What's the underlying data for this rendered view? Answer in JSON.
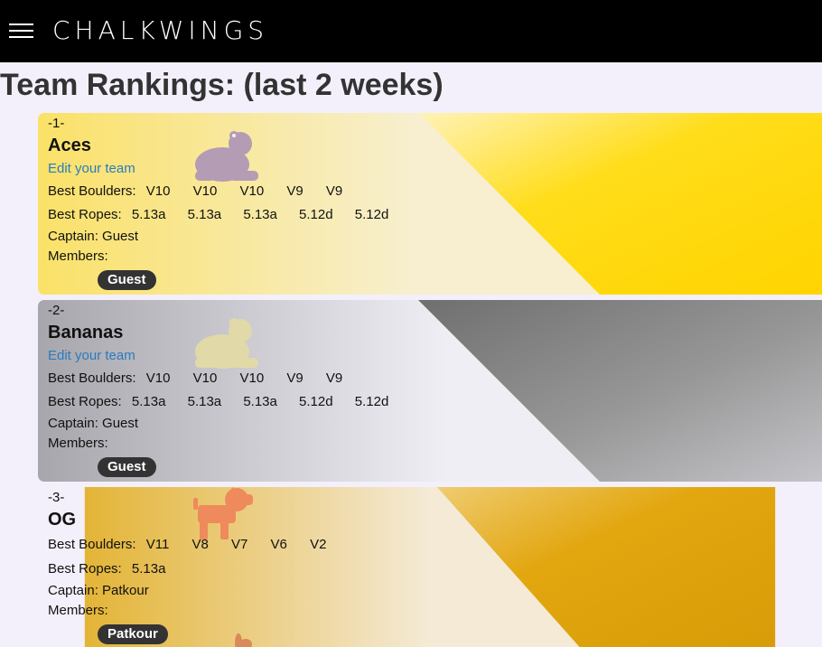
{
  "header": {
    "brand": "CHALKWINGS",
    "menu_icon": "hamburger-menu-icon"
  },
  "page_title": "Team Rankings: (last 2 weeks)",
  "teams": [
    {
      "rank": "-1-",
      "name": "Aces",
      "edit_label": "Edit your team",
      "boulders_label": "Best Boulders:",
      "boulders": [
        "V10",
        "V10",
        "V10",
        "V9",
        "V9"
      ],
      "ropes_label": "Best Ropes:",
      "ropes": [
        "5.13a",
        "5.13a",
        "5.13a",
        "5.12d",
        "5.12d"
      ],
      "captain": "Captain: Guest",
      "members_label": "Members:",
      "members": [
        "Guest"
      ],
      "icon": "frog-icon",
      "icon_color": "#b49cb4",
      "theme_colors": [
        "#fbe47a",
        "#ffd800"
      ]
    },
    {
      "rank": "-2-",
      "name": "Bananas",
      "edit_label": "Edit your team",
      "boulders_label": "Best Boulders:",
      "boulders": [
        "V10",
        "V10",
        "V10",
        "V9",
        "V9"
      ],
      "ropes_label": "Best Ropes:",
      "ropes": [
        "5.13a",
        "5.13a",
        "5.13a",
        "5.12d",
        "5.12d"
      ],
      "captain": "Captain: Guest",
      "members_label": "Members:",
      "members": [
        "Guest"
      ],
      "icon": "frog-icon",
      "icon_color": "#e2d9a8",
      "theme_colors": [
        "#a9a8ae",
        "#707070"
      ]
    },
    {
      "rank": "-3-",
      "name": "OG",
      "boulders_label": "Best Boulders:",
      "boulders": [
        "V11",
        "V8",
        "V7",
        "V6",
        "V2"
      ],
      "ropes_label": "Best Ropes:",
      "ropes": [
        "5.13a"
      ],
      "captain": "Captain: Patkour",
      "members_label": "Members:",
      "members": [
        "Patkour"
      ],
      "icon": "dog-icon",
      "icon_color": "#ef8a5c",
      "theme_colors": [
        "#e2b43a",
        "#dca20c"
      ]
    }
  ]
}
